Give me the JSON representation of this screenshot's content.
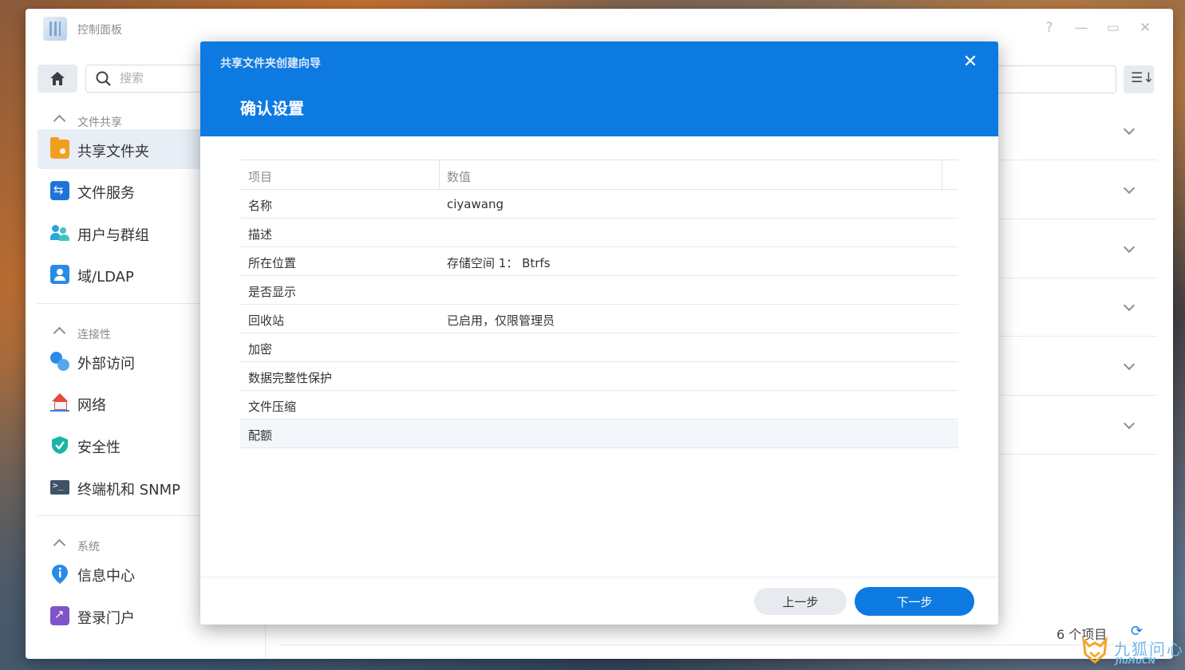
{
  "app": {
    "title": "控制面板",
    "window_controls": [
      "?",
      "—",
      "▭",
      "✕"
    ]
  },
  "sidebar": {
    "search_placeholder": "搜索",
    "sections": [
      {
        "label": "文件共享",
        "items": [
          {
            "label": "共享文件夹",
            "icon": "folder-share-icon",
            "active": true
          },
          {
            "label": "文件服务",
            "icon": "file-services-icon"
          },
          {
            "label": "用户与群组",
            "icon": "users-icon"
          },
          {
            "label": "域/LDAP",
            "icon": "domain-ldap-icon"
          }
        ]
      },
      {
        "label": "连接性",
        "items": [
          {
            "label": "外部访问",
            "icon": "external-access-icon"
          },
          {
            "label": "网络",
            "icon": "network-icon"
          },
          {
            "label": "安全性",
            "icon": "security-shield-icon"
          },
          {
            "label": "终端机和 SNMP",
            "icon": "terminal-icon"
          }
        ]
      },
      {
        "label": "系统",
        "items": [
          {
            "label": "信息中心",
            "icon": "info-center-icon"
          },
          {
            "label": "登录门户",
            "icon": "login-portal-icon"
          }
        ]
      }
    ]
  },
  "main": {
    "footer_count": "6 个项目"
  },
  "dialog": {
    "wizard_title": "共享文件夹创建向导",
    "title": "确认设置",
    "table": {
      "headers": [
        "项目",
        "数值"
      ],
      "rows": [
        {
          "item": "名称",
          "value": "ciyawang"
        },
        {
          "item": "描述",
          "value": ""
        },
        {
          "item": "所在位置",
          "value": "存储空间 1： Btrfs"
        },
        {
          "item": "是否显示",
          "value": ""
        },
        {
          "item": "回收站",
          "value": "已启用，仅限管理员"
        },
        {
          "item": "加密",
          "value": ""
        },
        {
          "item": "数据完整性保护",
          "value": ""
        },
        {
          "item": "文件压缩",
          "value": ""
        },
        {
          "item": "配额",
          "value": ""
        }
      ]
    },
    "buttons": {
      "prev": "上一步",
      "next": "下一步"
    }
  },
  "watermark": {
    "text": "九狐问心",
    "sub": "JiuHuCN"
  },
  "colors": {
    "accent": "#0d7ae1",
    "sidebar_active": "#e8eef6"
  }
}
